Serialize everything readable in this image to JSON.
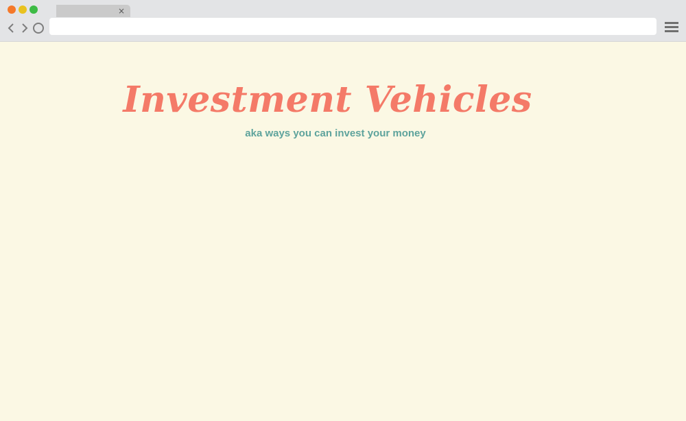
{
  "browser": {
    "tab": {
      "title": "",
      "close_glyph": "×"
    },
    "address_bar": {
      "value": ""
    },
    "controls": {
      "back_glyph": "‹",
      "forward_glyph": "›"
    },
    "window_buttons": {
      "close_color": "#f5792a",
      "minimize_color": "#e9c21f",
      "maximize_color": "#3dbb45"
    },
    "icons": [
      "back-icon",
      "forward-icon",
      "reload-icon",
      "hamburger-menu-icon",
      "close-icon"
    ]
  },
  "page": {
    "title": "Investment Vehicles",
    "subtitle": "aka ways you can invest your money",
    "colors": {
      "background": "#fbf8e4",
      "title": "#f47a68",
      "subtitle": "#5ea39c"
    }
  }
}
